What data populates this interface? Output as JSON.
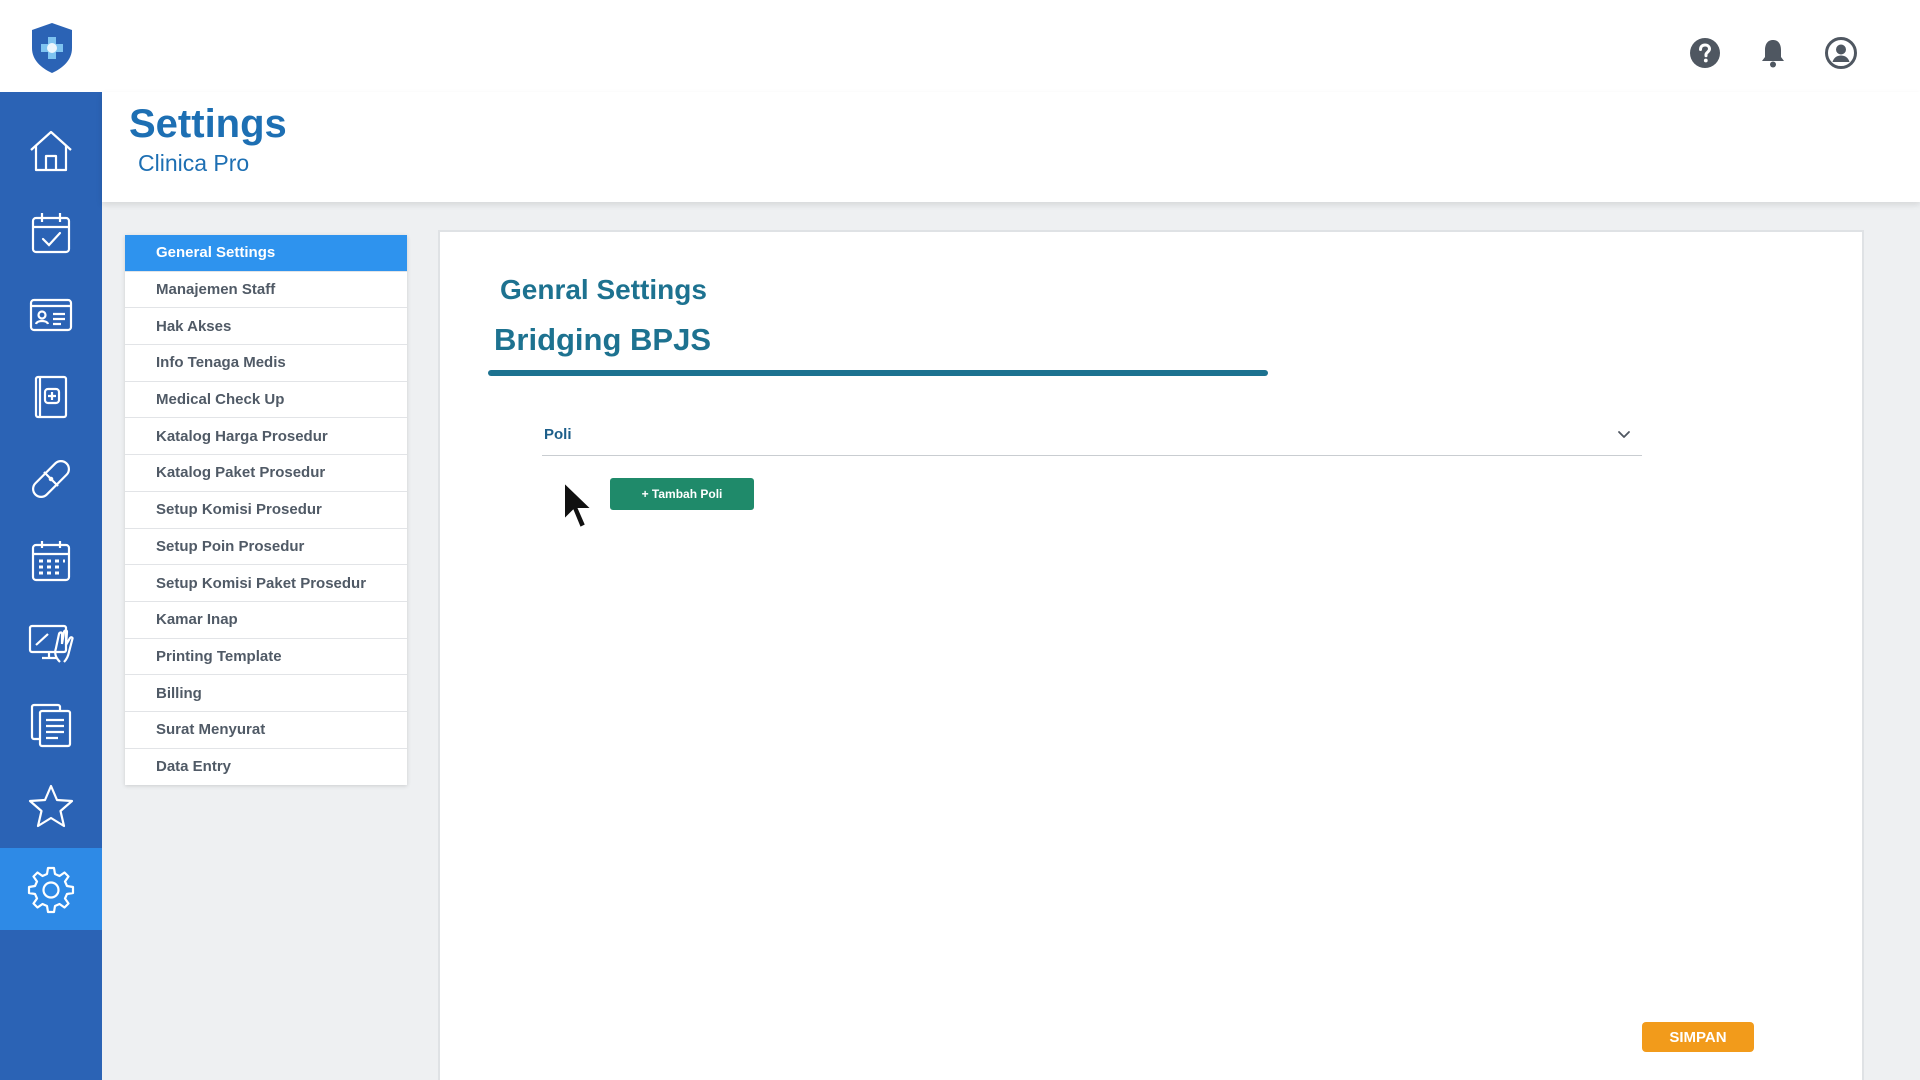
{
  "header": {
    "logo_icon": "shield-cross-logo",
    "actions": [
      {
        "name": "help-icon"
      },
      {
        "name": "bell-icon"
      },
      {
        "name": "user-account-icon"
      }
    ]
  },
  "rail": {
    "items": [
      {
        "icon": "home-icon"
      },
      {
        "icon": "calendar-check-icon"
      },
      {
        "icon": "id-card-icon"
      },
      {
        "icon": "medical-record-icon"
      },
      {
        "icon": "bandage-icon"
      },
      {
        "icon": "schedule-grid-icon"
      },
      {
        "icon": "monitor-hand-icon"
      },
      {
        "icon": "clipboard-list-icon"
      },
      {
        "icon": "star-icon"
      },
      {
        "icon": "gear-icon",
        "active": true
      }
    ]
  },
  "page": {
    "title": "Settings",
    "subtitle": "Clinica Pro"
  },
  "menu": {
    "items": [
      {
        "label": "General Settings",
        "active": true
      },
      {
        "label": "Manajemen Staff"
      },
      {
        "label": "Hak Akses"
      },
      {
        "label": "Info Tenaga Medis"
      },
      {
        "label": "Medical Check Up"
      },
      {
        "label": "Katalog Harga Prosedur"
      },
      {
        "label": "Katalog Paket Prosedur"
      },
      {
        "label": "Setup Komisi Prosedur"
      },
      {
        "label": "Setup Poin Prosedur"
      },
      {
        "label": "Setup Komisi Paket Prosedur"
      },
      {
        "label": "Kamar Inap"
      },
      {
        "label": "Printing Template"
      },
      {
        "label": "Billing"
      },
      {
        "label": "Surat Menyurat"
      },
      {
        "label": "Data Entry"
      }
    ]
  },
  "panel": {
    "heading": "Genral Settings",
    "subheading": "Bridging BPJS",
    "select": {
      "value": "Poli"
    },
    "add_button_label": "+ Tambah Poli",
    "save_button_label": "SIMPAN"
  },
  "colors": {
    "rail": "#2b63b5",
    "rail_active": "#2e8ae6",
    "title_blue": "#1d6fb3",
    "teal": "#1d7290",
    "menu_active": "#2e93ee",
    "add_button": "#1f8a6a",
    "save_button": "#f29b1b"
  }
}
